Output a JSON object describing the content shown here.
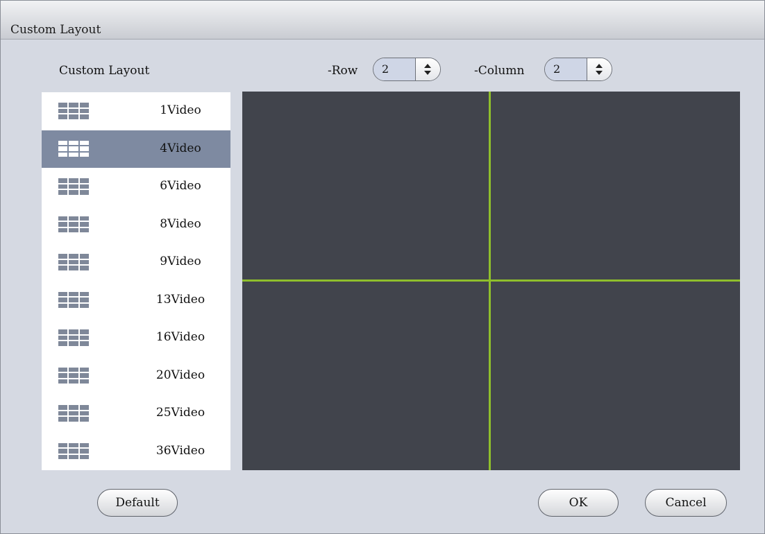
{
  "window": {
    "title": "Custom Layout"
  },
  "list_heading": "Custom Layout",
  "row": {
    "label": "-Row",
    "value": "2"
  },
  "column": {
    "label": "-Column",
    "value": "2"
  },
  "layouts": [
    {
      "label": "1Video",
      "selected": false
    },
    {
      "label": "4Video",
      "selected": true
    },
    {
      "label": "6Video",
      "selected": false
    },
    {
      "label": "8Video",
      "selected": false
    },
    {
      "label": "9Video",
      "selected": false
    },
    {
      "label": "13Video",
      "selected": false
    },
    {
      "label": "16Video",
      "selected": false
    },
    {
      "label": "20Video",
      "selected": false
    },
    {
      "label": "25Video",
      "selected": false
    },
    {
      "label": "36Video",
      "selected": false
    }
  ],
  "buttons": {
    "default": "Default",
    "ok": "OK",
    "cancel": "Cancel"
  },
  "colors": {
    "grid_line": "#8fbf2c",
    "preview_bg": "#41444c",
    "selected_row": "#7e8aa1"
  }
}
